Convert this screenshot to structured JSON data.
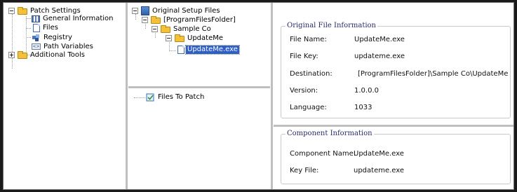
{
  "left_tree": {
    "root": "Patch Settings",
    "items": [
      "General Information",
      "Files",
      "Registry",
      "Path Variables"
    ],
    "second_root": "Additional Tools"
  },
  "upper_tree": {
    "root": "Original Setup Files",
    "level1": "[ProgramFilesFolder]",
    "level2": "Sample Co",
    "level3": "UpdateMe",
    "file": "UpdateMe.exe"
  },
  "lower_tree": {
    "root": "Files To Patch"
  },
  "original_info": {
    "title": "Original File Information",
    "rows": [
      {
        "label": "File Name:",
        "value": "UpdateMe.exe"
      },
      {
        "label": "File Key:",
        "value": "updateme.exe"
      },
      {
        "label": "Destination:",
        "value": "[ProgramFilesFolder]\\Sample Co\\UpdateMe"
      },
      {
        "label": "Version:",
        "value": "1.0.0.0"
      },
      {
        "label": "Language:",
        "value": "1033"
      }
    ]
  },
  "component_info": {
    "title": "Component Information",
    "rows": [
      {
        "label": "Component Name:",
        "value": "UpdateMe.exe"
      },
      {
        "label": "Key File:",
        "value": "updateme.exe"
      }
    ]
  },
  "colors": {
    "selection": "#2e5ec7",
    "group_title": "#2a2a6e",
    "folder": "#f4c23a"
  }
}
